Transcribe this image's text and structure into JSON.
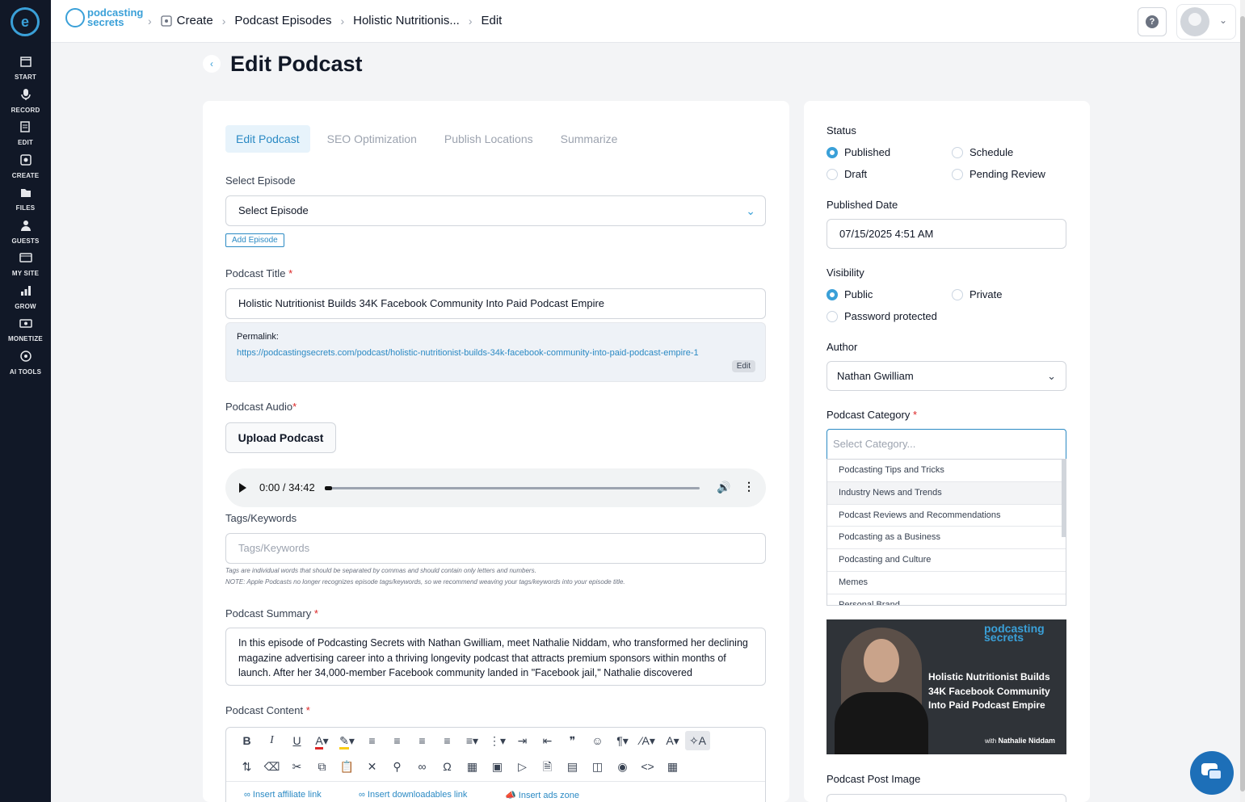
{
  "sidebar": {
    "items": [
      {
        "label": "START"
      },
      {
        "label": "RECORD"
      },
      {
        "label": "EDIT"
      },
      {
        "label": "CREATE"
      },
      {
        "label": "FILES"
      },
      {
        "label": "GUESTS"
      },
      {
        "label": "MY SITE"
      },
      {
        "label": "GROW"
      },
      {
        "label": "MONETIZE"
      },
      {
        "label": "AI TOOLS"
      }
    ]
  },
  "topbar": {
    "brand_line1": "podcasting",
    "brand_line2": "secrets",
    "breadcrumbs": [
      "Create",
      "Podcast Episodes",
      "Holistic Nutritionis...",
      "Edit"
    ],
    "help_icon": "?"
  },
  "page": {
    "title": "Edit Podcast"
  },
  "tabs": [
    "Edit Podcast",
    "SEO Optimization",
    "Publish Locations",
    "Summarize"
  ],
  "form": {
    "select_episode_label": "Select Episode",
    "select_episode_value": "Select Episode",
    "add_episode": "Add Episode",
    "title_label": "Podcast Title",
    "title_value": "Holistic Nutritionist Builds 34K Facebook Community Into Paid Podcast Empire",
    "permalink_label": "Permalink:",
    "permalink_url": "https://podcastingsecrets.com/podcast/holistic-nutritionist-builds-34k-facebook-community-into-paid-podcast-empire-1",
    "permalink_edit": "Edit",
    "audio_label": "Podcast Audio",
    "upload_button": "Upload Podcast",
    "audio_time": "0:00 / 34:42",
    "audio_progress": 0.02,
    "tags_label": "Tags/Keywords",
    "tags_placeholder": "Tags/Keywords",
    "tags_hint1": "Tags are individual words that should be separated by commas and should contain only letters and numbers.",
    "tags_hint2": "NOTE: Apple Podcasts no longer recognizes episode tags/keywords, so we recommend weaving your tags/keywords into your episode title.",
    "summary_label": "Podcast Summary",
    "summary_value": "In this episode of Podcasting Secrets with Nathan Gwilliam, meet Nathalie Niddam, who transformed her declining magazine advertising career into a thriving longevity podcast that attracts premium sponsors within months of launch. After her 34,000-member Facebook community landed in \"Facebook jail,\" Nathalie discovered",
    "content_label": "Podcast Content",
    "editor_links": [
      "Insert affiliate link",
      "Insert downloadables link",
      "Insert ads zone"
    ]
  },
  "side": {
    "status_label": "Status",
    "status_options": [
      "Published",
      "Schedule",
      "Draft",
      "Pending Review"
    ],
    "status_selected": "Published",
    "published_date_label": "Published Date",
    "published_date_value": "07/15/2025 4:51 AM",
    "visibility_label": "Visibility",
    "visibility_options": [
      "Public",
      "Private",
      "Password protected"
    ],
    "visibility_selected": "Public",
    "author_label": "Author",
    "author_value": "Nathan Gwilliam",
    "category_label": "Podcast Category",
    "category_placeholder": "Select Category...",
    "categories": [
      "Podcasting Tips and Tricks",
      "Industry News and Trends",
      "Podcast Reviews and Recommendations",
      "Podcasting as a Business",
      "Podcasting and Culture",
      "Memes",
      "Personal Brand"
    ],
    "highlighted_category": "Industry News and Trends",
    "cover_logo_line1": "podcasting",
    "cover_logo_line2": "secrets",
    "cover_title": "Holistic Nutritionist Builds 34K Facebook Community Into Paid Podcast Empire",
    "cover_with": "with",
    "cover_guest": "Nathalie Niddam",
    "post_image_label": "Podcast Post Image"
  },
  "colors": {
    "accent": "#3aa0d8",
    "link": "#2b8ac4",
    "nav_bg": "#111827",
    "required": "#dc2626"
  }
}
